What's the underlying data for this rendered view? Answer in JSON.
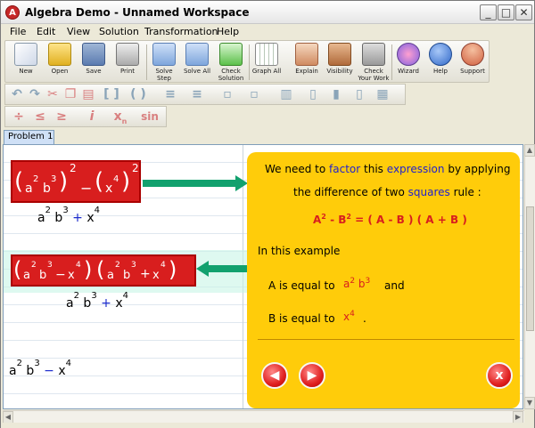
{
  "window": {
    "title": "Algebra Demo - Unnamed Workspace"
  },
  "menu": [
    "File",
    "Edit",
    "View",
    "Solution",
    "Transformation",
    "Help"
  ],
  "toolbar": {
    "new": "New",
    "open": "Open",
    "save": "Save",
    "print": "Print",
    "solve_step": "Solve Step",
    "solve_all": "Solve All",
    "check_solution": "Check Solution",
    "graph_all": "Graph All",
    "explain": "Explain",
    "visibility": "Visibility",
    "check_work": "Check Your Work",
    "wizard": "Wizard",
    "help": "Help",
    "support": "Support"
  },
  "symbols": {
    "divide": "÷",
    "le": "≤",
    "ge": "≥",
    "info": "i",
    "xsub": "x",
    "sub": "n",
    "sin": "sin"
  },
  "tabs": {
    "problem": "Problem 1"
  },
  "workspace": {
    "expr1_box": {
      "a": "a",
      "e2": "2",
      "b": "b",
      "e3": "3",
      "outer": "2",
      "minus": "−",
      "x": "x",
      "e4": "4",
      "outer2": "2"
    },
    "expr1_result": {
      "a": "a",
      "e2": "2",
      "b": "b",
      "e3": "3",
      "op": "+",
      "x": "x",
      "e4": "4"
    },
    "expr2_box": {
      "a": "a",
      "e2": "2",
      "b": "b",
      "e3": "3",
      "minus": "−",
      "x": "x",
      "e4": "4",
      "a2": "a",
      "e2b": "2",
      "b2": "b",
      "e3b": "3",
      "plus": "+",
      "x2": "x",
      "e4b": "4"
    },
    "expr2_result": {
      "a": "a",
      "e2": "2",
      "b": "b",
      "e3": "3",
      "op": "+",
      "x": "x",
      "e4": "4"
    },
    "expr3": {
      "a": "a",
      "e2": "2",
      "b": "b",
      "e3": "3",
      "op": "−",
      "x": "x",
      "e4": "4"
    }
  },
  "panel": {
    "line1a": "We need to",
    "kw_factor": "factor",
    "line1b": "this",
    "kw_expression": "expression",
    "line1c": "by applying",
    "line2a": "the difference of two",
    "kw_squares": "squares",
    "line2b": "rule :",
    "rule_A": "A",
    "rule_e1": "2",
    "rule_minus": "- B",
    "rule_e2": "2",
    "rule_rhs": "= ( A - B ) ( A + B )",
    "example": "In this example",
    "a_label": "A is equal to",
    "a_val_a": "a",
    "a_val_e2": "2",
    "a_val_b": "b",
    "a_val_e3": "3",
    "a_and": "and",
    "b_label": "B is equal to",
    "b_val_x": "x",
    "b_val_e4": "4",
    "b_dot": ".",
    "prev": "◀",
    "next": "▶",
    "close": "x"
  },
  "colors": {
    "panel": "#ffcc0a",
    "expr_box": "#d81e1e",
    "arrow": "#12a16e",
    "keyword": "#2222cc"
  }
}
